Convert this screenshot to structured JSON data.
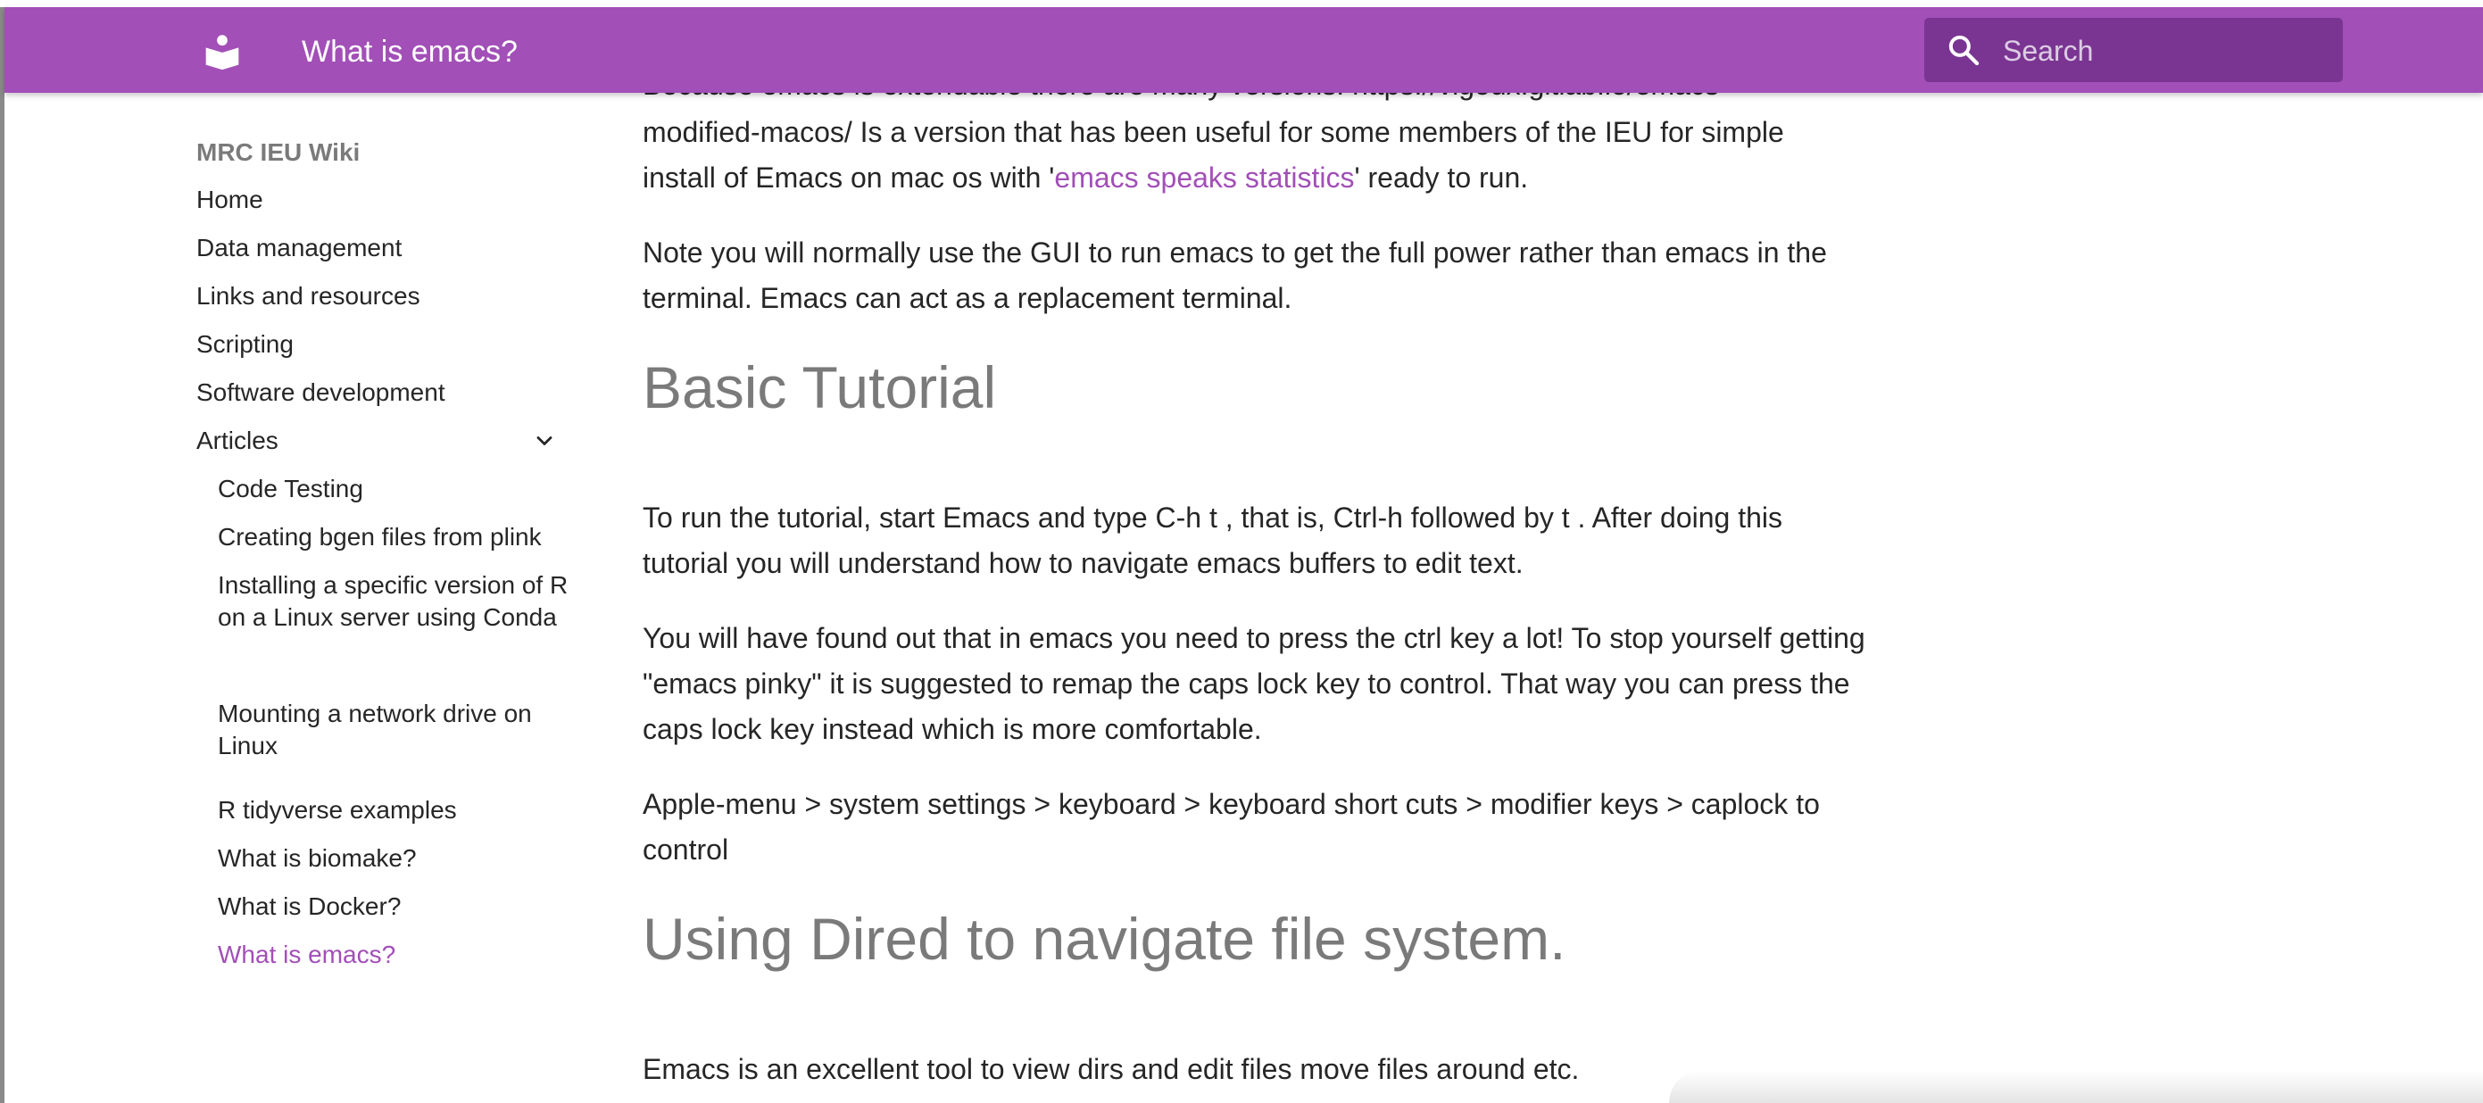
{
  "header": {
    "title": "What is emacs?",
    "logo_icon": "book-reader-icon",
    "search_placeholder": "Search",
    "color": "#a24fb7"
  },
  "sidebar": {
    "title": "MRC IEU Wiki",
    "items": [
      {
        "label": "Home"
      },
      {
        "label": "Data management"
      },
      {
        "label": "Links and resources"
      },
      {
        "label": "Scripting"
      },
      {
        "label": "Software development"
      },
      {
        "label": "Articles",
        "expanded": true
      }
    ],
    "articles": [
      {
        "label": "Code Testing"
      },
      {
        "label": "Creating bgen files from plink"
      },
      {
        "label": "Installing a specific version of R on a Linux server using Conda"
      },
      {
        "label": "Mounting a network drive on Linux"
      },
      {
        "label": "R tidyverse examples"
      },
      {
        "label": "What is biomake?"
      },
      {
        "label": "What is Docker?"
      },
      {
        "label": "What is emacs?",
        "active": true
      }
    ]
  },
  "content": {
    "p1_clipped": "Because emacs is extendable there are many versions. https://vigoux.gitlab.io/emacs-",
    "p1_line2": "modified-macos/ Is a version that has been useful for some members of the IEU for simple",
    "p1_line3_before": "install of Emacs on mac os with '",
    "p1_link": "emacs speaks statistics",
    "p1_line3_after": "' ready to run.",
    "p2": "Note you will normally use the GUI to run emacs to get the full power rather than emacs in the terminal. Emacs can act as a replacement terminal.",
    "h_basic": "Basic Tutorial",
    "p3": "To run the tutorial, start Emacs and type C-h t , that is, Ctrl-h followed by t . After doing this tutorial you will understand how to navigate emacs buffers to edit text.",
    "p4": "You will have found out that in emacs you need to press the ctrl key a lot! To stop yourself getting \"emacs pinky\" it is suggested to remap the caps lock key to control. That way you can press the caps lock key instead which is more comfortable.",
    "p5": "Apple-menu > system settings > keyboard > keyboard short cuts > modifier keys > caplock to control",
    "h_dired": "Using Dired to navigate file system.",
    "p6": "Emacs is an excellent tool to view dirs and edit files move files around etc."
  }
}
